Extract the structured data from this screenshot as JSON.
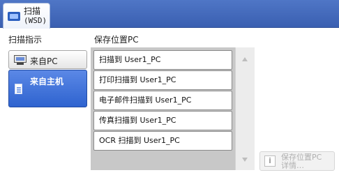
{
  "header": {
    "tab_title": "扫描",
    "tab_sub": "(WSD)",
    "tab_icon": "wsd-scanner-icon"
  },
  "left": {
    "title": "扫描指示",
    "options": [
      {
        "label": "来自PC",
        "icon": "pc-icon",
        "selected": false
      },
      {
        "label": "来自主机",
        "icon": "host-document-icon",
        "selected": true
      }
    ]
  },
  "right": {
    "title": "保存位置PC",
    "items": [
      "扫描到 User1_PC",
      "打印扫描到 User1_PC",
      "电子邮件扫描到 User1_PC",
      "传真扫描到 User1_PC",
      "OCR 扫描到 User1_PC"
    ]
  },
  "details_button": {
    "line1": "保存位置PC",
    "line2": "详情…",
    "icon": "info-icon",
    "enabled": false
  }
}
